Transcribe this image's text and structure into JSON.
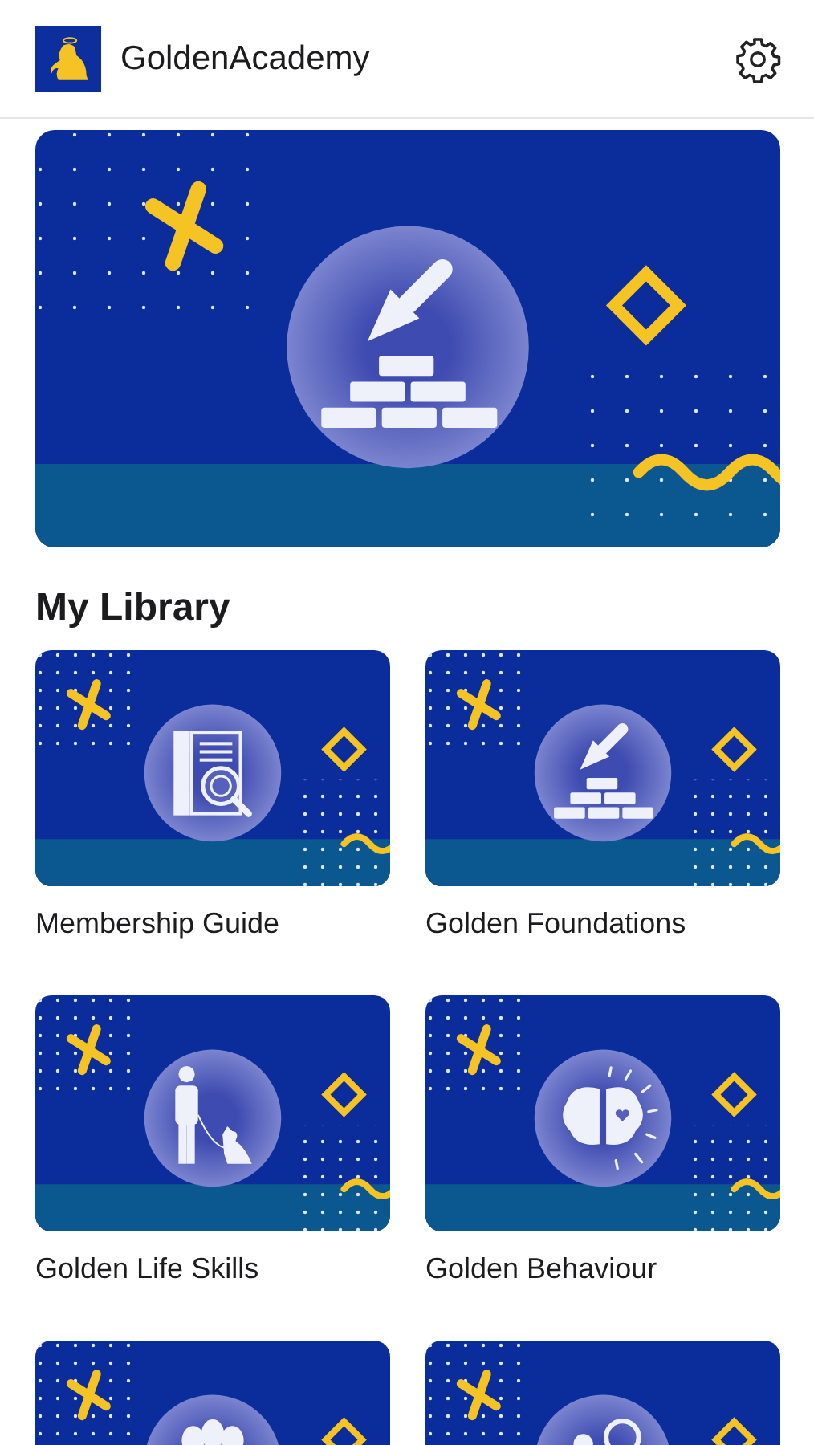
{
  "header": {
    "title": "GoldenAcademy"
  },
  "section_title": "My Library",
  "courses": [
    {
      "title": "Membership Guide"
    },
    {
      "title": "Golden Foundations"
    },
    {
      "title": "Golden Life Skills"
    },
    {
      "title": "Golden Behaviour"
    },
    {
      "kind": "picture"
    },
    {
      "kind": "picture"
    }
  ]
}
